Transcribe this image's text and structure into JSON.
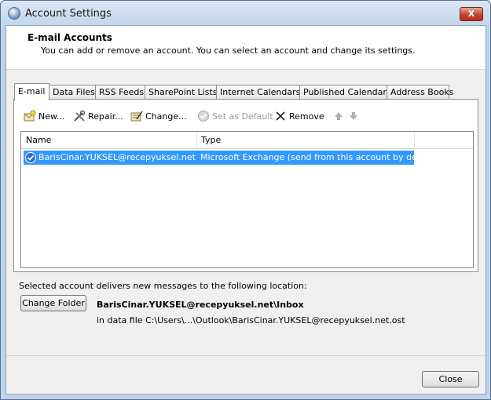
{
  "window": {
    "title": "Account Settings",
    "close_glyph": "X"
  },
  "header": {
    "title": "E-mail Accounts",
    "subtitle": "You can add or remove an account. You can select an account and change its settings."
  },
  "tabs": [
    {
      "label": "E-mail",
      "active": true
    },
    {
      "label": "Data Files"
    },
    {
      "label": "RSS Feeds"
    },
    {
      "label": "SharePoint Lists"
    },
    {
      "label": "Internet Calendars"
    },
    {
      "label": "Published Calendars"
    },
    {
      "label": "Address Books"
    }
  ],
  "toolbar": {
    "new_label": "New...",
    "repair_label": "Repair...",
    "change_label": "Change...",
    "set_default_label": "Set as Default",
    "remove_label": "Remove"
  },
  "accounts_list": {
    "columns": [
      "Name",
      "Type"
    ],
    "rows": [
      {
        "name": "BarisCinar.YUKSEL@recepyuksel.net",
        "type": "Microsoft Exchange (send from this account by default)",
        "selected": true,
        "icon": "default-check-icon"
      }
    ]
  },
  "delivery": {
    "label": "Selected account delivers new messages to the following location:",
    "change_folder_label": "Change Folder",
    "location": "BarisCinar.YUKSEL@recepyuksel.net\\Inbox",
    "data_file": "in data file C:\\Users\\...\\Outlook\\BarisCinar.YUKSEL@recepyuksel.net.ost"
  },
  "footer": {
    "close_label": "Close"
  },
  "colors": {
    "selection": "#3399ff",
    "frame": "#bfd3ea",
    "close_button": "#c4452b"
  }
}
